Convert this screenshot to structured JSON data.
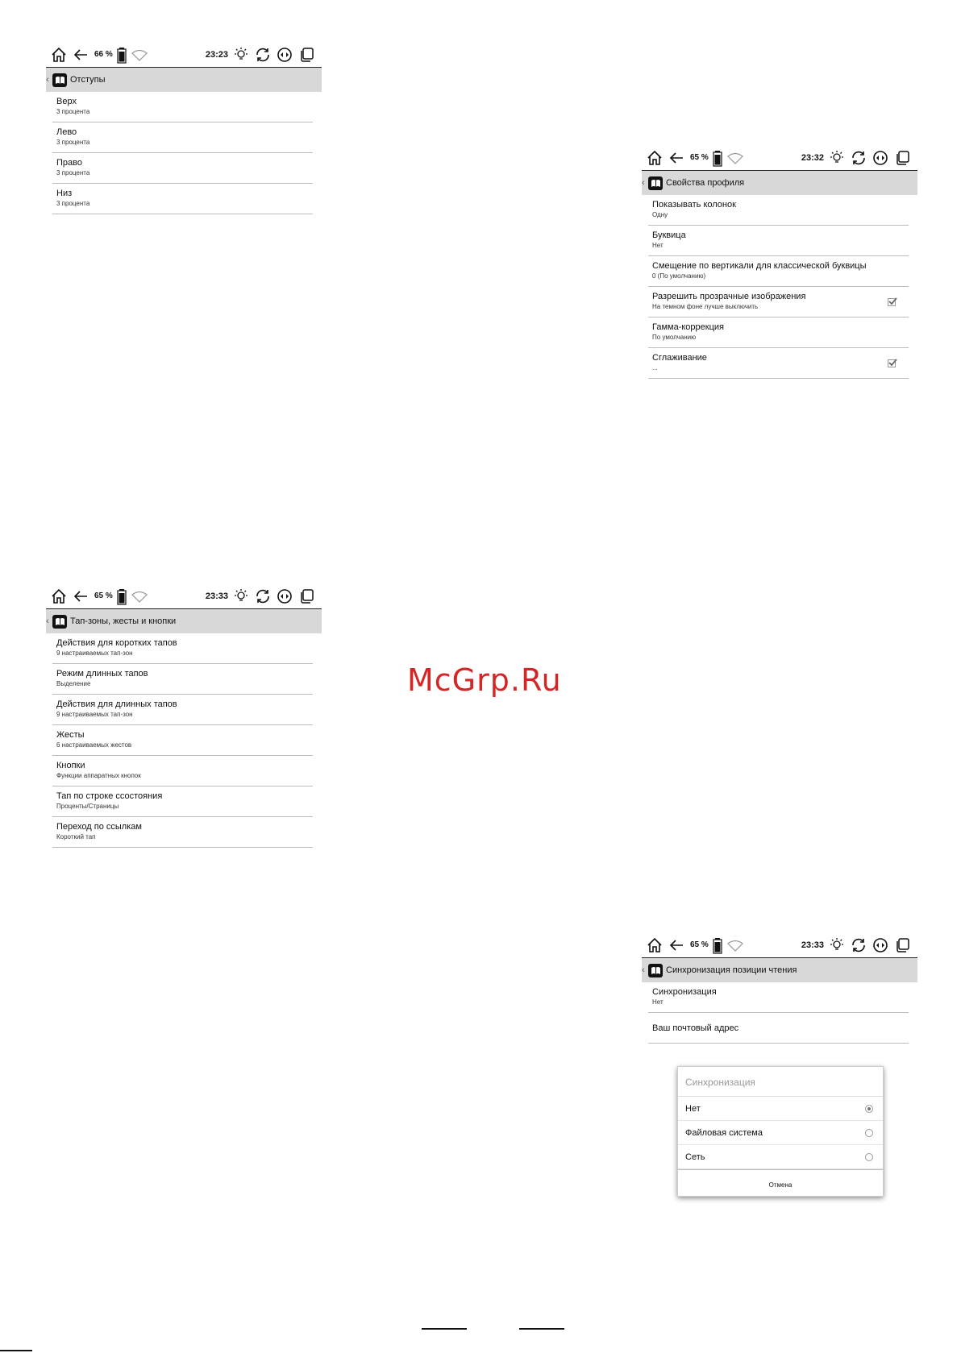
{
  "screens": [
    {
      "status": {
        "battery": "66 %",
        "time": "23:23"
      },
      "title": "Отступы",
      "items": [
        {
          "label": "Верх",
          "sub": "3 процента"
        },
        {
          "label": "Лево",
          "sub": "3 процента"
        },
        {
          "label": "Право",
          "sub": "3 процента"
        },
        {
          "label": "Низ",
          "sub": "3 процента"
        }
      ]
    },
    {
      "status": {
        "battery": "65 %",
        "time": "23:32"
      },
      "title": "Свойства профиля",
      "items": [
        {
          "label": "Показывать колонок",
          "sub": "Одну"
        },
        {
          "label": "Буквица",
          "sub": "Нет"
        },
        {
          "label": "Смещение по вертикали для классической буквицы",
          "sub": "0 (По умолчанию)"
        },
        {
          "label": "Разрешить прозрачные изображения",
          "sub": "На темном фоне лучше выключить",
          "checked": true
        },
        {
          "label": "Гамма-коррекция",
          "sub": "По умолчанию"
        },
        {
          "label": "Сглаживание",
          "sub": "...",
          "checked": true
        }
      ]
    },
    {
      "status": {
        "battery": "65 %",
        "time": "23:33"
      },
      "title": "Тап-зоны, жесты и кнопки",
      "items": [
        {
          "label": "Действия для коротких тапов",
          "sub": "9 настраиваемых тап-зон"
        },
        {
          "label": "Режим длинных тапов",
          "sub": "Выделение"
        },
        {
          "label": "Действия для длинных тапов",
          "sub": "9 настраиваемых тап-зон"
        },
        {
          "label": "Жесты",
          "sub": "6 настраиваемых жестов"
        },
        {
          "label": "Кнопки",
          "sub": "Функции аппаратных кнопок"
        },
        {
          "label": "Тап по строке ссостояния",
          "sub": "Проценты/Страницы"
        },
        {
          "label": "Переход по ссылкам",
          "sub": "Короткий тап"
        }
      ]
    },
    {
      "status": {
        "battery": "65 %",
        "time": "23:33"
      },
      "title": "Синхронизация позиции чтения",
      "items": [
        {
          "label": "Синхронизация",
          "sub": "Нет"
        },
        {
          "label": "Ваш почтовый адрес",
          "sub": ""
        }
      ]
    }
  ],
  "dialog": {
    "title": "Синхронизация",
    "options": [
      "Нет",
      "Файловая система",
      "Сеть"
    ],
    "selected": "Нет",
    "cancel": "Отмена"
  },
  "watermark": "McGrp.Ru"
}
